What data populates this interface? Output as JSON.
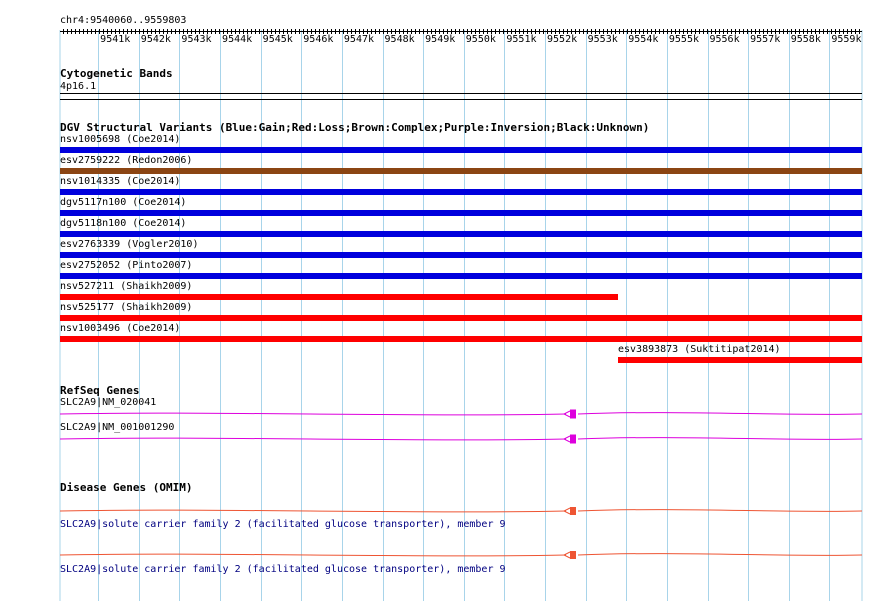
{
  "coordinate_range": "chr4:9540060..9559803",
  "scale_ticks": [
    "9541k",
    "9542k",
    "9543k",
    "9544k",
    "9545k",
    "9546k",
    "9547k",
    "9548k",
    "9549k",
    "9550k",
    "9551k",
    "9552k",
    "9553k",
    "9554k",
    "9555k",
    "9556k",
    "9557k",
    "9558k",
    "9559k"
  ],
  "cytogenetic": {
    "title": "Cytogenetic Bands",
    "band": "4p16.1"
  },
  "dgv": {
    "title": "DGV Structural Variants (Blue:Gain;Red:Loss;Brown:Complex;Purple:Inversion;Black:Unknown)",
    "colors": {
      "gain": "#0000dd",
      "loss": "#ff0000",
      "complex": "#8b4513"
    },
    "items": [
      {
        "label": "nsv1005698 (Coe2014)",
        "type": "gain",
        "start": 9540060,
        "end": 9559803
      },
      {
        "label": "esv2759222 (Redon2006)",
        "type": "complex",
        "start": 9540060,
        "end": 9559803
      },
      {
        "label": "nsv1014335 (Coe2014)",
        "type": "gain",
        "start": 9540060,
        "end": 9559803
      },
      {
        "label": "dgv5117n100 (Coe2014)",
        "type": "gain",
        "start": 9540060,
        "end": 9559803
      },
      {
        "label": "dgv5118n100 (Coe2014)",
        "type": "gain",
        "start": 9540060,
        "end": 9559803
      },
      {
        "label": "esv2763339 (Vogler2010)",
        "type": "gain",
        "start": 9540060,
        "end": 9559803
      },
      {
        "label": "esv2752052 (Pinto2007)",
        "type": "gain",
        "start": 9540060,
        "end": 9559803
      },
      {
        "label": "nsv527211 (Shaikh2009)",
        "type": "loss",
        "start": 9540060,
        "end": 9553800
      },
      {
        "label": "nsv525177 (Shaikh2009)",
        "type": "loss",
        "start": 9540060,
        "end": 9559803
      },
      {
        "label": "nsv1003496 (Coe2014)",
        "type": "loss",
        "start": 9540060,
        "end": 9559803
      },
      {
        "label": "esv3893873 (Suktitipat2014)",
        "type": "loss",
        "start": 9553800,
        "end": 9559803
      }
    ]
  },
  "refseq": {
    "title": "RefSeq Genes",
    "color": "#dd00dd",
    "items": [
      {
        "label": "SLC2A9|NM_020041"
      },
      {
        "label": "SLC2A9|NM_001001290"
      }
    ]
  },
  "omim": {
    "title": "Disease Genes (OMIM)",
    "color": "#ee5533",
    "items": [
      {
        "label": "SLC2A9|solute carrier family 2 (facilitated glucose transporter), member 9"
      },
      {
        "label": "SLC2A9|solute carrier family 2 (facilitated glucose transporter), member 9"
      }
    ]
  }
}
